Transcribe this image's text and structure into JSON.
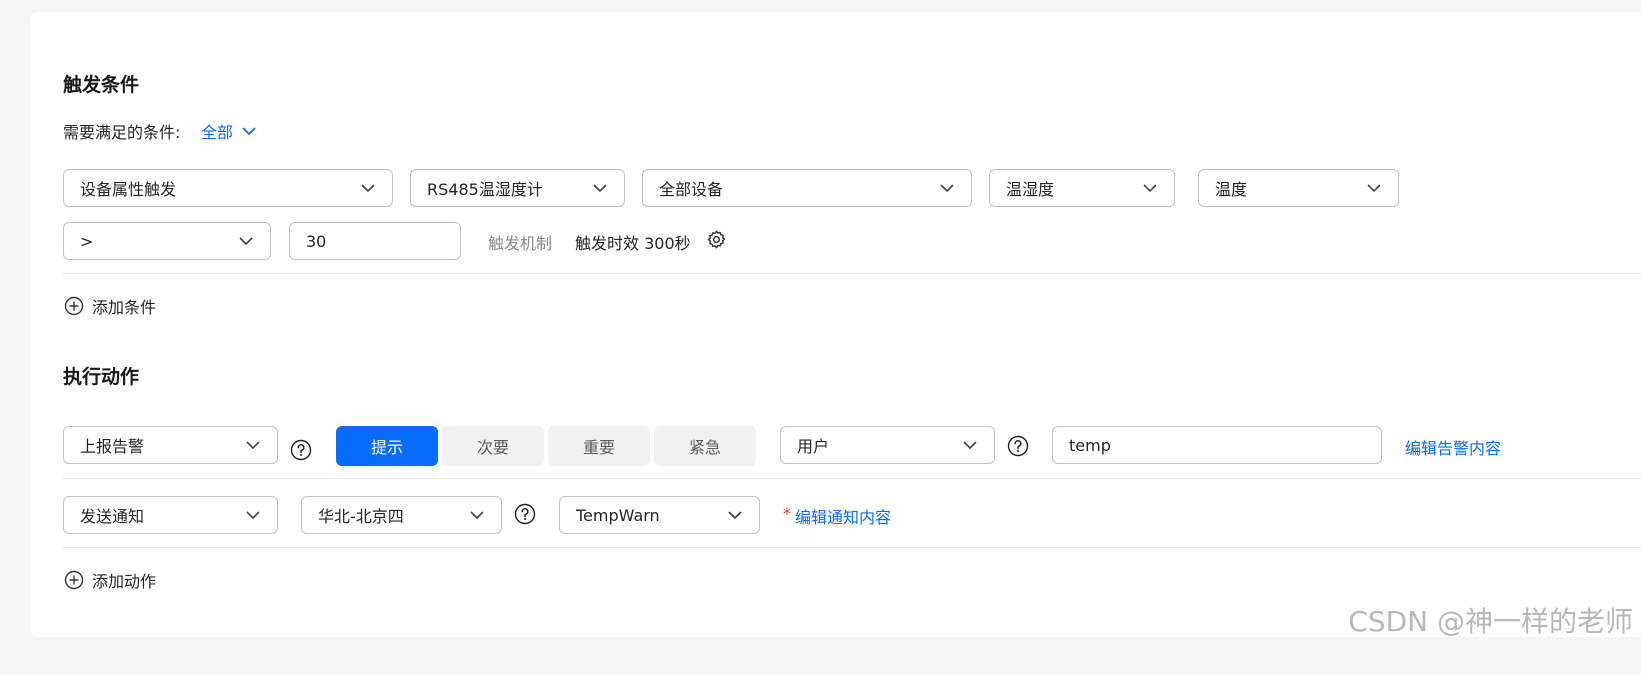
{
  "trigger": {
    "title": "触发条件",
    "condition_label": "需要满足的条件:",
    "condition_value": "全部",
    "selects": {
      "type": "设备属性触发",
      "product": "RS485温湿度计",
      "device": "全部设备",
      "service": "温湿度",
      "property": "温度",
      "operator": ">"
    },
    "value": "30",
    "mechanism_label": "触发机制",
    "mechanism_value": "触发时效 300秒",
    "add_label": "添加条件"
  },
  "action": {
    "title": "执行动作",
    "alarm": {
      "type": "上报告警",
      "levels": [
        "提示",
        "次要",
        "重要",
        "紧急"
      ],
      "active_level": 0,
      "scope": "用户",
      "name_value": "temp",
      "edit_link": "编辑告警内容"
    },
    "notify": {
      "type": "发送通知",
      "region": "华北-北京四",
      "template": "TempWarn",
      "required_mark": "*",
      "edit_link": "编辑通知内容"
    },
    "add_label": "添加动作"
  },
  "watermark": "CSDN @神一样的老师",
  "colors": {
    "accent": "#0a6cff",
    "border": "#c2c2c2",
    "segment_bg": "#f1f1f1",
    "required": "#e0342b"
  }
}
